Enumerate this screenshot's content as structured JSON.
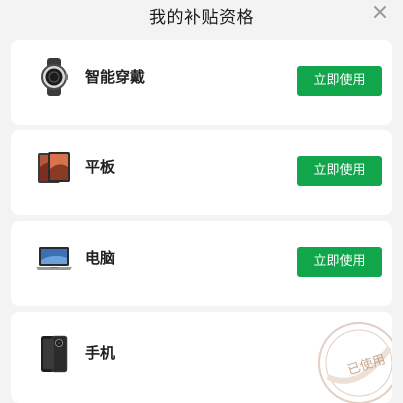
{
  "header": {
    "title": "我的补贴资格",
    "close_icon": "close-icon"
  },
  "colors": {
    "accent": "#12a64c",
    "stamp": "#c9a790"
  },
  "subsidies": [
    {
      "name": "智能穿戴",
      "icon": "smartwatch-icon",
      "action": "立即使用",
      "status": "available"
    },
    {
      "name": "平板",
      "icon": "tablet-icon",
      "action": "立即使用",
      "status": "available"
    },
    {
      "name": "电脑",
      "icon": "laptop-icon",
      "action": "立即使用",
      "status": "available"
    },
    {
      "name": "手机",
      "icon": "phone-icon",
      "stamp": "已使用",
      "status": "used"
    }
  ]
}
